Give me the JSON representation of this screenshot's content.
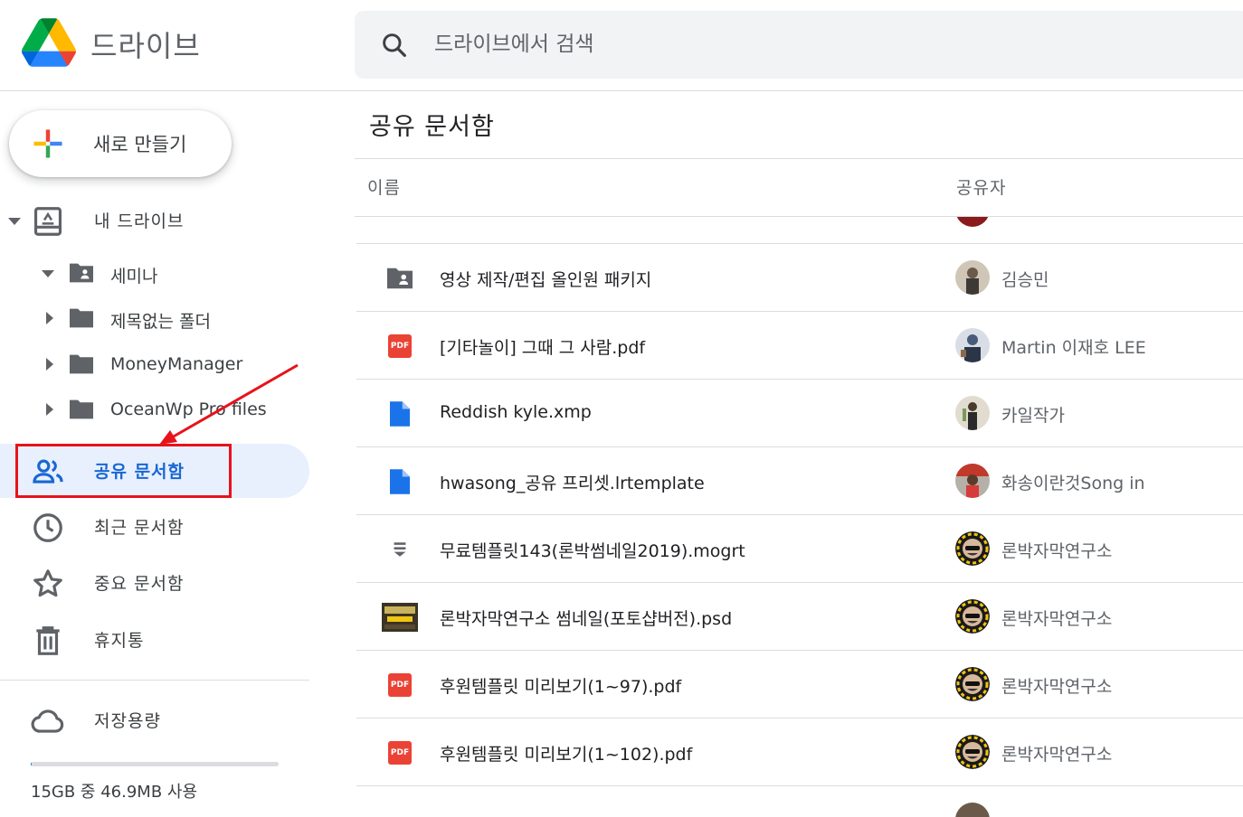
{
  "app": {
    "title": "드라이브"
  },
  "search": {
    "placeholder": "드라이브에서 검색"
  },
  "sidebar": {
    "new_label": "새로 만들기",
    "my_drive": "내 드라이브",
    "tree": [
      {
        "label": "세미나",
        "expanded": true,
        "shared": true
      },
      {
        "label": "제목없는 폴더",
        "expanded": false,
        "shared": false
      },
      {
        "label": "MoneyManager",
        "expanded": false,
        "shared": false
      },
      {
        "label": "OceanWp Pro files",
        "expanded": false,
        "shared": false
      }
    ],
    "shared_with_me": "공유 문서함",
    "recent": "최근 문서함",
    "starred": "중요 문서함",
    "trash": "휴지통",
    "storage_label": "저장용량",
    "storage_text": "15GB 중 46.9MB 사용",
    "storage_used_fraction": 0.003
  },
  "main": {
    "title": "공유 문서함",
    "columns": {
      "name": "이름",
      "owner": "공유자"
    },
    "rows": [
      {
        "name": "영상 제작/편집 올인원 패키지",
        "type": "shared-folder",
        "owner": "김승민",
        "avatar_color": "#7d6b5a"
      },
      {
        "name": "[기타놀이] 그때 그 사람.pdf",
        "type": "pdf",
        "owner": "Martin 이재호 LEE",
        "avatar_color": "#4a5a7a"
      },
      {
        "name": "Reddish kyle.xmp",
        "type": "doc",
        "owner": "카일작가",
        "avatar_color": "#8a7a66"
      },
      {
        "name": "hwasong_공유 프리셋.lrtemplate",
        "type": "doc",
        "owner": "화송이란것Song in",
        "avatar_color": "#c0392b"
      },
      {
        "name": "무료템플릿143(론박썸네일2019).mogrt",
        "type": "mogrt",
        "owner": "론박자막연구소",
        "avatar_color": "#2c3e50"
      },
      {
        "name": "론박자막연구소 썸네일(포토샵버전).psd",
        "type": "psd",
        "owner": "론박자막연구소",
        "avatar_color": "#2c3e50"
      },
      {
        "name": "후원템플릿 미리보기(1~97).pdf",
        "type": "pdf",
        "owner": "론박자막연구소",
        "avatar_color": "#2c3e50"
      },
      {
        "name": "후원템플릿 미리보기(1~102).pdf",
        "type": "pdf",
        "owner": "론박자막연구소",
        "avatar_color": "#2c3e50"
      }
    ]
  },
  "colors": {
    "accent": "#1967d2",
    "active_bg": "#e8f0fe",
    "highlight": "#e8121a",
    "pdf": "#ea4335",
    "doc": "#1a73e8"
  },
  "icons": {
    "logo": "google-drive-logo",
    "search": "search-icon",
    "new": "plus-icon",
    "my_drive": "drive-icon",
    "shared": "people-icon",
    "recent": "clock-icon",
    "starred": "star-icon",
    "trash": "trash-icon",
    "storage": "cloud-icon"
  }
}
